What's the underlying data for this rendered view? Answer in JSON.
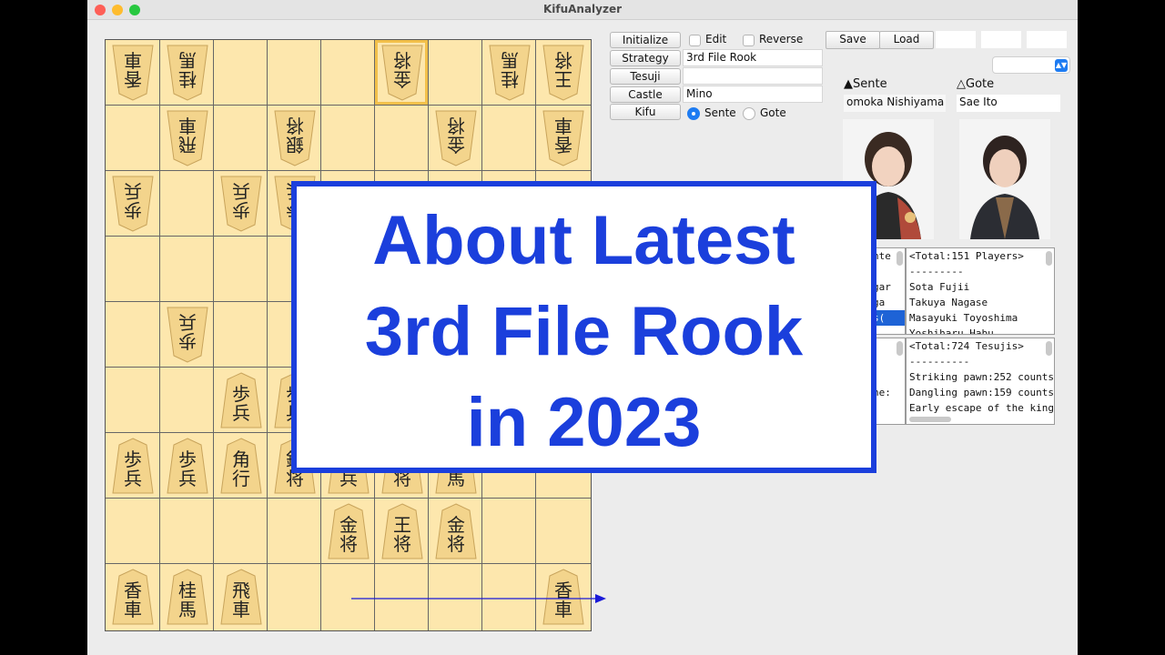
{
  "window": {
    "title": "KifuAnalyzer"
  },
  "toolbar": {
    "initialize": "Initialize",
    "edit": "Edit",
    "reverse": "Reverse",
    "save": "Save",
    "load": "Load",
    "strategy": "Strategy",
    "strategy_value": "3rd File Rook",
    "tesuji": "Tesuji",
    "tesuji_value": "",
    "castle": "Castle",
    "castle_value": "Mino",
    "kifu": "Kifu",
    "sente": "Sente",
    "gote": "Gote"
  },
  "players": {
    "sente_label": "▲Sente",
    "sente_name": "omoka Nishiyama",
    "gote_label": "△Gote",
    "gote_name": "Sae Ito"
  },
  "left_list_fragments": [
    "nte",
    "gar",
    "ga",
    "s("
  ],
  "tesuji_fragment": "ne:",
  "players_list": {
    "header": "<Total:151 Players>",
    "sep": "---------",
    "items": [
      "Sota Fujii",
      "Takuya Nagase",
      "Masayuki Toyoshima",
      "Yoshiharu Habu"
    ]
  },
  "tesuji_list": {
    "header": "<Total:724 Tesujis>",
    "sep": "----------",
    "items": [
      "Striking pawn:252 counts",
      "Dangling pawn:159 counts",
      "Early escape of the king c"
    ]
  },
  "banner": {
    "line1": "About Latest",
    "line2": "3rd File Rook",
    "line3": "in 2023"
  },
  "pieces": [
    {
      "r": 0,
      "c": 0,
      "t": "香車",
      "g": true
    },
    {
      "r": 0,
      "c": 1,
      "t": "桂馬",
      "g": true
    },
    {
      "r": 0,
      "c": 5,
      "t": "金将",
      "g": true
    },
    {
      "r": 0,
      "c": 7,
      "t": "桂馬",
      "g": true
    },
    {
      "r": 0,
      "c": 8,
      "t": "王将",
      "g": true
    },
    {
      "r": 1,
      "c": 1,
      "t": "飛車",
      "g": true
    },
    {
      "r": 1,
      "c": 3,
      "t": "銀将",
      "g": true
    },
    {
      "r": 1,
      "c": 6,
      "t": "金将",
      "g": true
    },
    {
      "r": 1,
      "c": 8,
      "t": "香車",
      "g": true
    },
    {
      "r": 2,
      "c": 0,
      "t": "歩兵",
      "g": true
    },
    {
      "r": 2,
      "c": 2,
      "t": "歩兵",
      "g": true
    },
    {
      "r": 2,
      "c": 3,
      "t": "歩兵",
      "g": true
    },
    {
      "r": 4,
      "c": 1,
      "t": "歩兵",
      "g": true
    },
    {
      "r": 5,
      "c": 2,
      "t": "歩兵",
      "g": false
    },
    {
      "r": 5,
      "c": 3,
      "t": "歩兵",
      "g": false
    },
    {
      "r": 6,
      "c": 0,
      "t": "歩兵",
      "g": false
    },
    {
      "r": 6,
      "c": 1,
      "t": "歩兵",
      "g": false
    },
    {
      "r": 6,
      "c": 2,
      "t": "角行",
      "g": false
    },
    {
      "r": 6,
      "c": 3,
      "t": "銀将",
      "g": false
    },
    {
      "r": 6,
      "c": 4,
      "t": "歩兵",
      "g": false
    },
    {
      "r": 6,
      "c": 5,
      "t": "銀将",
      "g": false
    },
    {
      "r": 6,
      "c": 6,
      "t": "桂馬",
      "g": false
    },
    {
      "r": 7,
      "c": 4,
      "t": "金将",
      "g": false
    },
    {
      "r": 7,
      "c": 5,
      "t": "王将",
      "g": false
    },
    {
      "r": 7,
      "c": 6,
      "t": "金将",
      "g": false
    },
    {
      "r": 8,
      "c": 0,
      "t": "香車",
      "g": false
    },
    {
      "r": 8,
      "c": 1,
      "t": "桂馬",
      "g": false
    },
    {
      "r": 8,
      "c": 2,
      "t": "飛車",
      "g": false
    },
    {
      "r": 8,
      "c": 8,
      "t": "香車",
      "g": false
    }
  ],
  "colors": {
    "accent": "#1b3fdc",
    "board": "#fde7ad",
    "piece": "#f3d48c"
  }
}
